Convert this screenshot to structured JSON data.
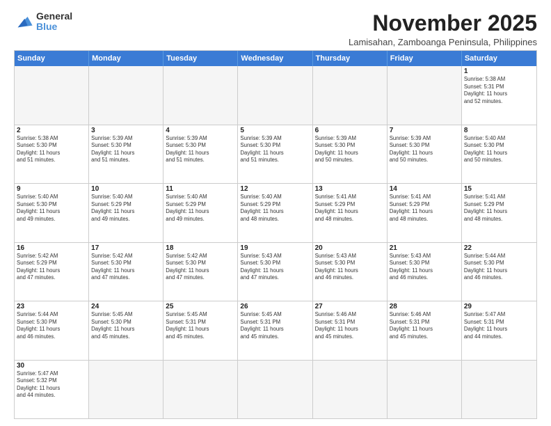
{
  "logo": {
    "line1": "General",
    "line2": "Blue"
  },
  "title": "November 2025",
  "subtitle": "Lamisahan, Zamboanga Peninsula, Philippines",
  "header_days": [
    "Sunday",
    "Monday",
    "Tuesday",
    "Wednesday",
    "Thursday",
    "Friday",
    "Saturday"
  ],
  "weeks": [
    [
      {
        "day": "",
        "info": ""
      },
      {
        "day": "",
        "info": ""
      },
      {
        "day": "",
        "info": ""
      },
      {
        "day": "",
        "info": ""
      },
      {
        "day": "",
        "info": ""
      },
      {
        "day": "",
        "info": ""
      },
      {
        "day": "1",
        "info": "Sunrise: 5:38 AM\nSunset: 5:31 PM\nDaylight: 11 hours\nand 52 minutes."
      }
    ],
    [
      {
        "day": "2",
        "info": "Sunrise: 5:38 AM\nSunset: 5:30 PM\nDaylight: 11 hours\nand 51 minutes."
      },
      {
        "day": "3",
        "info": "Sunrise: 5:39 AM\nSunset: 5:30 PM\nDaylight: 11 hours\nand 51 minutes."
      },
      {
        "day": "4",
        "info": "Sunrise: 5:39 AM\nSunset: 5:30 PM\nDaylight: 11 hours\nand 51 minutes."
      },
      {
        "day": "5",
        "info": "Sunrise: 5:39 AM\nSunset: 5:30 PM\nDaylight: 11 hours\nand 51 minutes."
      },
      {
        "day": "6",
        "info": "Sunrise: 5:39 AM\nSunset: 5:30 PM\nDaylight: 11 hours\nand 50 minutes."
      },
      {
        "day": "7",
        "info": "Sunrise: 5:39 AM\nSunset: 5:30 PM\nDaylight: 11 hours\nand 50 minutes."
      },
      {
        "day": "8",
        "info": "Sunrise: 5:40 AM\nSunset: 5:30 PM\nDaylight: 11 hours\nand 50 minutes."
      }
    ],
    [
      {
        "day": "9",
        "info": "Sunrise: 5:40 AM\nSunset: 5:30 PM\nDaylight: 11 hours\nand 49 minutes."
      },
      {
        "day": "10",
        "info": "Sunrise: 5:40 AM\nSunset: 5:29 PM\nDaylight: 11 hours\nand 49 minutes."
      },
      {
        "day": "11",
        "info": "Sunrise: 5:40 AM\nSunset: 5:29 PM\nDaylight: 11 hours\nand 49 minutes."
      },
      {
        "day": "12",
        "info": "Sunrise: 5:40 AM\nSunset: 5:29 PM\nDaylight: 11 hours\nand 48 minutes."
      },
      {
        "day": "13",
        "info": "Sunrise: 5:41 AM\nSunset: 5:29 PM\nDaylight: 11 hours\nand 48 minutes."
      },
      {
        "day": "14",
        "info": "Sunrise: 5:41 AM\nSunset: 5:29 PM\nDaylight: 11 hours\nand 48 minutes."
      },
      {
        "day": "15",
        "info": "Sunrise: 5:41 AM\nSunset: 5:29 PM\nDaylight: 11 hours\nand 48 minutes."
      }
    ],
    [
      {
        "day": "16",
        "info": "Sunrise: 5:42 AM\nSunset: 5:29 PM\nDaylight: 11 hours\nand 47 minutes."
      },
      {
        "day": "17",
        "info": "Sunrise: 5:42 AM\nSunset: 5:30 PM\nDaylight: 11 hours\nand 47 minutes."
      },
      {
        "day": "18",
        "info": "Sunrise: 5:42 AM\nSunset: 5:30 PM\nDaylight: 11 hours\nand 47 minutes."
      },
      {
        "day": "19",
        "info": "Sunrise: 5:43 AM\nSunset: 5:30 PM\nDaylight: 11 hours\nand 47 minutes."
      },
      {
        "day": "20",
        "info": "Sunrise: 5:43 AM\nSunset: 5:30 PM\nDaylight: 11 hours\nand 46 minutes."
      },
      {
        "day": "21",
        "info": "Sunrise: 5:43 AM\nSunset: 5:30 PM\nDaylight: 11 hours\nand 46 minutes."
      },
      {
        "day": "22",
        "info": "Sunrise: 5:44 AM\nSunset: 5:30 PM\nDaylight: 11 hours\nand 46 minutes."
      }
    ],
    [
      {
        "day": "23",
        "info": "Sunrise: 5:44 AM\nSunset: 5:30 PM\nDaylight: 11 hours\nand 46 minutes."
      },
      {
        "day": "24",
        "info": "Sunrise: 5:45 AM\nSunset: 5:30 PM\nDaylight: 11 hours\nand 45 minutes."
      },
      {
        "day": "25",
        "info": "Sunrise: 5:45 AM\nSunset: 5:31 PM\nDaylight: 11 hours\nand 45 minutes."
      },
      {
        "day": "26",
        "info": "Sunrise: 5:45 AM\nSunset: 5:31 PM\nDaylight: 11 hours\nand 45 minutes."
      },
      {
        "day": "27",
        "info": "Sunrise: 5:46 AM\nSunset: 5:31 PM\nDaylight: 11 hours\nand 45 minutes."
      },
      {
        "day": "28",
        "info": "Sunrise: 5:46 AM\nSunset: 5:31 PM\nDaylight: 11 hours\nand 45 minutes."
      },
      {
        "day": "29",
        "info": "Sunrise: 5:47 AM\nSunset: 5:31 PM\nDaylight: 11 hours\nand 44 minutes."
      }
    ],
    [
      {
        "day": "30",
        "info": "Sunrise: 5:47 AM\nSunset: 5:32 PM\nDaylight: 11 hours\nand 44 minutes."
      },
      {
        "day": "",
        "info": ""
      },
      {
        "day": "",
        "info": ""
      },
      {
        "day": "",
        "info": ""
      },
      {
        "day": "",
        "info": ""
      },
      {
        "day": "",
        "info": ""
      },
      {
        "day": "",
        "info": ""
      }
    ]
  ]
}
